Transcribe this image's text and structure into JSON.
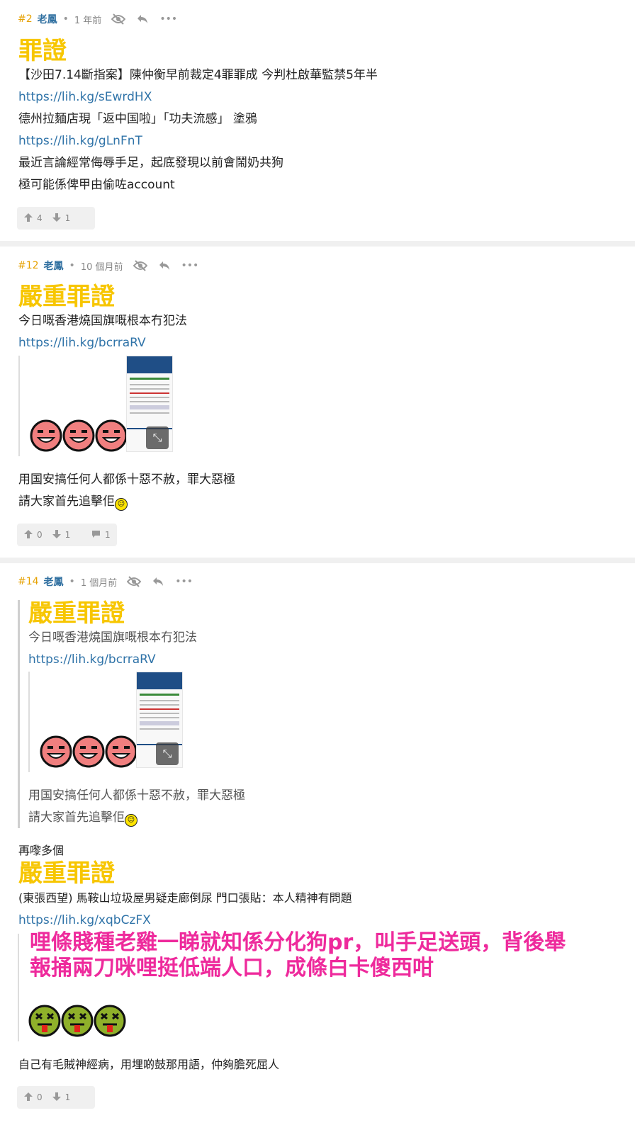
{
  "posts": [
    {
      "num": "#2",
      "author": "老鳳",
      "time": "1 年前",
      "title": "罪證",
      "lines": [
        "【沙田7.14斷指案】陳仲衡早前裁定4罪罪成 今判杜啟華監禁5年半",
        "https://lih.kg/sEwrdHX",
        "德州拉麵店現「返中国啦」「功夫流感」 塗鴉",
        "https://lih.kg/gLnFnT",
        "最近言論經常侮辱手足，起底發現以前會鬧奶共狗",
        "極可能係俾甲由偷咗account"
      ],
      "up": "4",
      "down": "1"
    },
    {
      "num": "#12",
      "author": "老鳳",
      "time": "10 個月前",
      "title": "嚴重罪證",
      "lines": [
        "今日嘅香港燒国旗嘅根本冇犯法",
        "https://lih.kg/bcrraRV",
        "用国安搞任何人都係十惡不赦，罪大惡極",
        "請大家首先追擊佢"
      ],
      "up": "0",
      "down": "1",
      "replies": "1"
    },
    {
      "num": "#14",
      "author": "老鳳",
      "time": "1 個月前",
      "quote_title": "嚴重罪證",
      "quote_lines": [
        "今日嘅香港燒国旗嘅根本冇犯法",
        "https://lih.kg/bcrraRV",
        "用国安搞任何人都係十惡不赦，罪大惡極",
        "請大家首先追擊佢"
      ],
      "intro": "再嚟多個",
      "title": "嚴重罪證",
      "lines": [
        "(東張西望) 馬鞍山垃圾屋男疑走廊倒尿 門口張貼：本人精神有問題",
        "https://lih.kg/xqbCzFX"
      ],
      "pink": [
        "哩條賤種老雞一睇就知係分化狗pr，叫手足送頭，背後舉",
        "報捅兩刀咪哩挺低端人口，成條白卡傻西咁"
      ],
      "outro": "自己有毛賊神經病，用埋啲鼓那用語，仲夠膽死屈人",
      "up": "0",
      "down": "1"
    }
  ],
  "icons": {
    "hide": "eye-slash-icon",
    "reply": "reply-icon",
    "more": "more-icon",
    "up": "thumb-up-icon",
    "down": "thumb-down-icon",
    "comment": "comment-icon"
  },
  "colors": {
    "title_yellow": "#f7c600",
    "link_blue": "#2f73a8",
    "pink": "#ee2a9c",
    "post_num": "#e6a100"
  }
}
